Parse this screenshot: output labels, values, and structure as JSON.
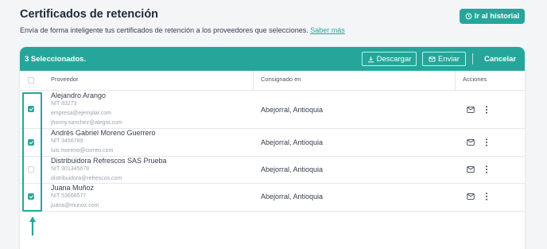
{
  "page": {
    "title": "Certificados de retención",
    "subtitle": "Envía de forma inteligente tus certificados de retención a los proveedores que selecciones.",
    "learn_more": "Saber más",
    "history_button": "Ir al historial"
  },
  "toolbar": {
    "selected_count": "3 Seleccionados.",
    "download_label": "Descargar",
    "send_label": "Enviar",
    "cancel_label": "Cancelar"
  },
  "table": {
    "headers": [
      "Proveedor",
      "Consignado en",
      "Acciones"
    ],
    "rows": [
      {
        "name": "Alejandro Arango",
        "nit": "NIT 83273",
        "email": "empresa@ejemplar.com",
        "email2": "jhonny.sanchez@alegra.com",
        "place": "Abejorral, Antioquia",
        "checked": true
      },
      {
        "name": "Andrés Gabriel Moreno Guerrero",
        "nit": "NIT 3456789",
        "email": "luis.moreno@correo.com",
        "place": "Abejorral, Antioquia",
        "checked": true
      },
      {
        "name": "Distribuidora Refrescos SAS Prueba",
        "nit": "NIT 901345678",
        "email": "distribuidora@refrescos.com",
        "place": "Abejorral, Antioquia",
        "checked": false
      },
      {
        "name": "Juana Muñoz",
        "nit": "NIT 53666577",
        "email": "juana@munoz.com",
        "place": "Abejorral, Antioquia",
        "checked": true
      }
    ]
  },
  "colors": {
    "accent": "#26a69a",
    "highlight_border": "#b2f5ea"
  },
  "icons": [
    "history-icon",
    "download-icon",
    "mail-icon",
    "more-vertical-icon",
    "arrow-right-icon",
    "arrow-up-icon"
  ]
}
